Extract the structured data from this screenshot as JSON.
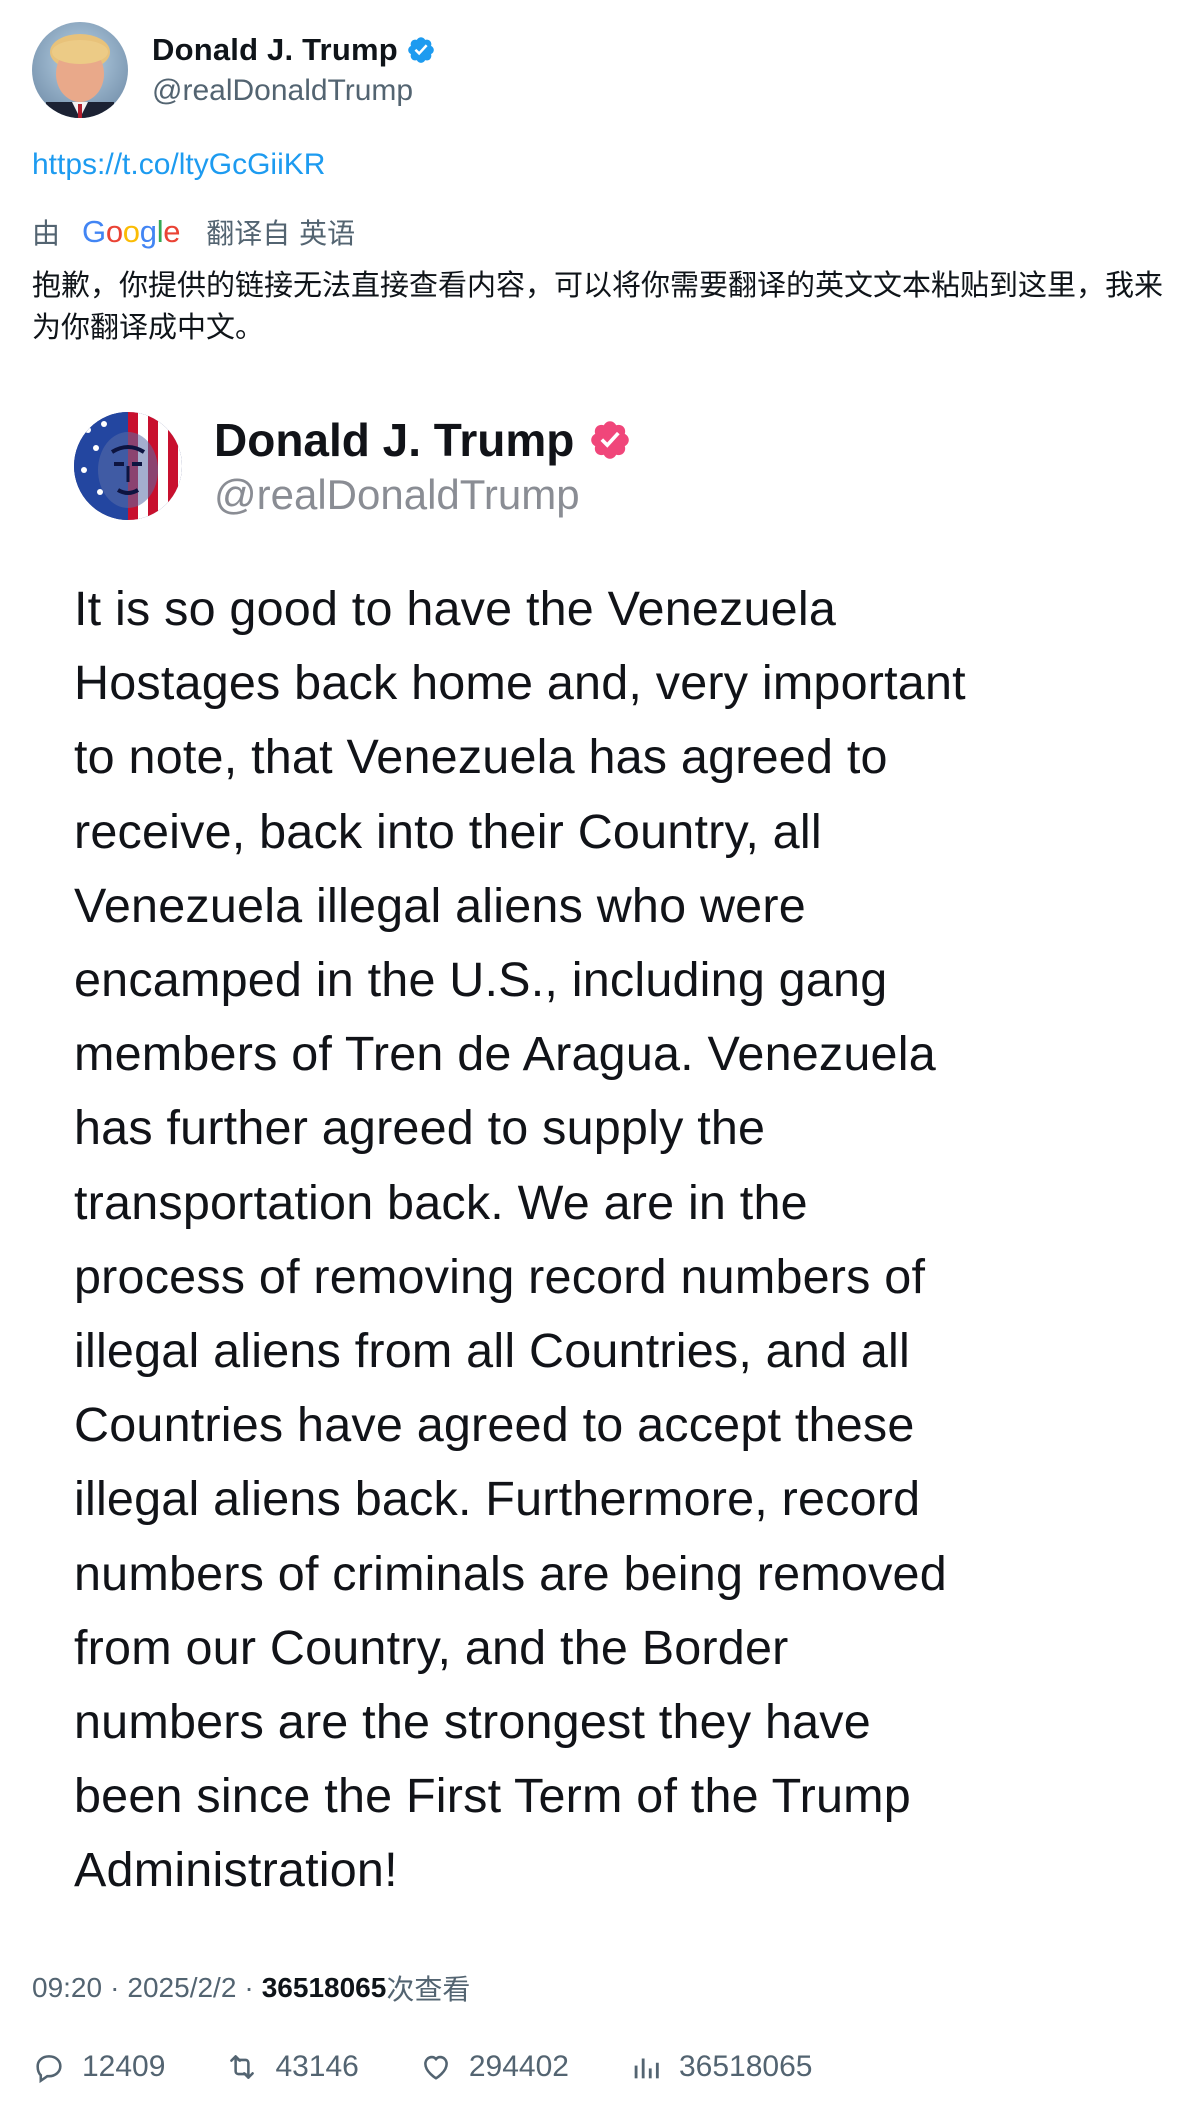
{
  "author": {
    "display_name": "Donald J. Trump",
    "handle": "@realDonaldTrump",
    "verified_color": "#1d9bf0"
  },
  "tweet": {
    "link": "https://t.co/ltyGcGiiKR"
  },
  "translation": {
    "prefix": "由",
    "provider": "Google",
    "suffix": "翻译自 英语",
    "text": "抱歉，你提供的链接无法直接查看内容，可以将你需要翻译的英文文本粘贴到这里，我来为你翻译成中文。"
  },
  "embedded_post": {
    "display_name": "Donald J. Trump",
    "handle": "@realDonaldTrump",
    "verified_color": "#f0467a",
    "body": "It is so good to have the Venezuela\nHostages back home and, very important\nto note, that Venezuela has agreed to\nreceive, back into their Country, all\nVenezuela illegal aliens who were\nencamped in the U.S., including gang\nmembers of Tren de Aragua. Venezuela\nhas further agreed to supply the\ntransportation back. We are in the\nprocess of removing record numbers of\nillegal aliens from all Countries, and all\nCountries have agreed to accept these\nillegal aliens back. Furthermore, record\nnumbers of criminals are being removed\nfrom our Country, and the Border\nnumbers are the strongest they have\nbeen since the First Term of the Trump\nAdministration!"
  },
  "meta": {
    "time": "09:20",
    "separator": "·",
    "date": "2025/2/2",
    "views": "36518065",
    "views_label": "次查看"
  },
  "stats": {
    "replies": "12409",
    "reposts": "43146",
    "likes": "294402",
    "views": "36518065"
  },
  "icons": {
    "verified": "verified-badge-icon",
    "reply": "reply-icon",
    "repost": "repost-icon",
    "like": "heart-icon",
    "views": "bar-chart-icon"
  }
}
